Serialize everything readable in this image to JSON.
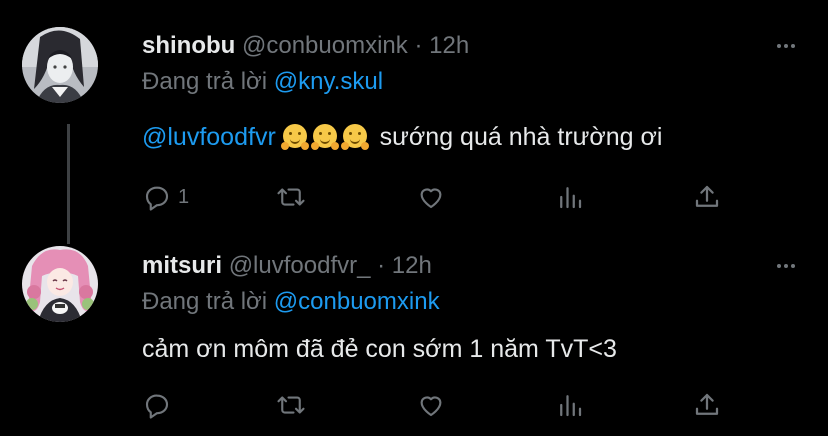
{
  "tweets": [
    {
      "name": "shinobu",
      "handle": "@conbuomxink",
      "dot": "·",
      "time": "12h",
      "reply_prefix": "Đang trả lời",
      "reply_to": "@kny.skul",
      "text_mention": "@luvfoodfvr",
      "text": "sướng quá nhà trường ơi",
      "reply_count": "1",
      "avatar_icon": "avatar-shinobu"
    },
    {
      "name": "mitsuri",
      "handle": "@luvfoodfvr_",
      "dot": "·",
      "time": "12h",
      "reply_prefix": "Đang trả lời",
      "reply_to": "@conbuomxink",
      "text": "cảm ơn môm đã đẻ con sớm 1 năm TvT<3",
      "reply_count": "",
      "avatar_icon": "avatar-mitsuri"
    }
  ],
  "icons": [
    "reply-icon",
    "retweet-icon",
    "like-icon",
    "analytics-icon",
    "share-icon",
    "more-icon"
  ],
  "colors": {
    "background": "#000000",
    "text": "#e7e9ea",
    "muted": "#71767b",
    "accent": "#1d9bf0",
    "thread_line": "#3e4144"
  }
}
